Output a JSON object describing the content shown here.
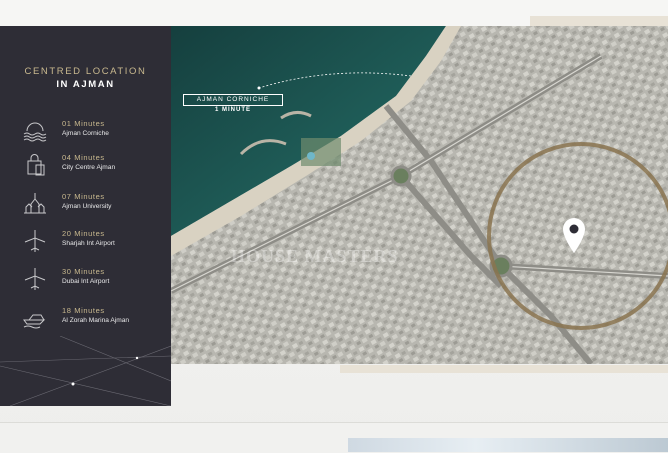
{
  "sidebar": {
    "title": "CENTRED LOCATION",
    "subtitle": "IN AJMAN",
    "items": [
      {
        "minutes": "01 Minutes",
        "place": "Ajman Corniche",
        "icon": "waves-icon"
      },
      {
        "minutes": "04 Minutes",
        "place": "City Centre Ajman",
        "icon": "shopping-bag-icon"
      },
      {
        "minutes": "07 Minutes",
        "place": "Ajman University",
        "icon": "university-icon"
      },
      {
        "minutes": "20 Minutes",
        "place": "Sharjah Int Airport",
        "icon": "airplane-icon"
      },
      {
        "minutes": "30 Minutes",
        "place": "Dubai Int Airport",
        "icon": "airplane-icon"
      },
      {
        "minutes": "18 Minutes",
        "place": "Al Zorah Marina Ajman",
        "icon": "yacht-icon"
      }
    ]
  },
  "map": {
    "label": "AJMAN CORNICHE",
    "label_sub": "1 MINUTE",
    "watermark": "HOUSE MASTERS",
    "colors": {
      "sea": "#1f5a56",
      "beach": "#d9d2c2",
      "urban": "#b7b6ae",
      "accent": "#c9b98f"
    }
  }
}
